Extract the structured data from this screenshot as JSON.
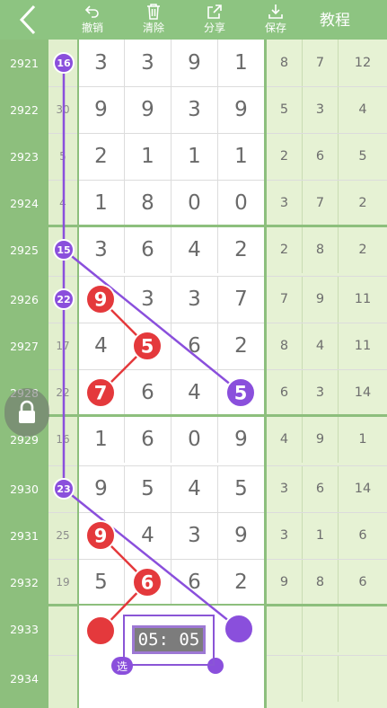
{
  "toolbar": {
    "undo_label": "撤销",
    "clear_label": "清除",
    "share_label": "分享",
    "save_label": "保存",
    "tutorial_label": "教程"
  },
  "colors": {
    "header_green": "#8dc481",
    "rownum_green": "#8dbf7d",
    "side_col_bg": "#e2efce",
    "right_col_bg": "#e6f2d4",
    "red_ball": "#e4393c",
    "purple_ball": "#8a4fdc"
  },
  "rows": [
    {
      "num": "2921",
      "side": "16",
      "main": [
        "3",
        "3",
        "9",
        "1"
      ],
      "right": [
        "8",
        "7",
        "12"
      ]
    },
    {
      "num": "2922",
      "side": "30",
      "main": [
        "9",
        "9",
        "3",
        "9"
      ],
      "right": [
        "5",
        "3",
        "4"
      ]
    },
    {
      "num": "2923",
      "side": "5",
      "main": [
        "2",
        "1",
        "1",
        "1"
      ],
      "right": [
        "2",
        "6",
        "5"
      ]
    },
    {
      "num": "2924",
      "side": "4",
      "main": [
        "1",
        "8",
        "0",
        "0"
      ],
      "right": [
        "3",
        "7",
        "2"
      ]
    },
    {
      "num": "2925",
      "side": "15",
      "main": [
        "3",
        "6",
        "4",
        "2"
      ],
      "right": [
        "2",
        "8",
        "2"
      ]
    },
    {
      "num": "2926",
      "side": "22",
      "main": [
        "9",
        "3",
        "3",
        "7"
      ],
      "right": [
        "7",
        "9",
        "11"
      ]
    },
    {
      "num": "2927",
      "side": "17",
      "main": [
        "4",
        "5",
        "6",
        "2"
      ],
      "right": [
        "8",
        "4",
        "11"
      ]
    },
    {
      "num": "2928",
      "side": "22",
      "main": [
        "7",
        "6",
        "4",
        "5"
      ],
      "right": [
        "6",
        "3",
        "14"
      ]
    },
    {
      "num": "2929",
      "side": "16",
      "main": [
        "1",
        "6",
        "0",
        "9"
      ],
      "right": [
        "4",
        "9",
        "1"
      ]
    },
    {
      "num": "2930",
      "side": "23",
      "main": [
        "9",
        "5",
        "4",
        "5"
      ],
      "right": [
        "3",
        "6",
        "14"
      ]
    },
    {
      "num": "2931",
      "side": "25",
      "main": [
        "9",
        "4",
        "3",
        "9"
      ],
      "right": [
        "3",
        "1",
        "6"
      ]
    },
    {
      "num": "2932",
      "side": "19",
      "main": [
        "5",
        "6",
        "6",
        "2"
      ],
      "right": [
        "9",
        "8",
        "6"
      ]
    },
    {
      "num": "2933",
      "side": "",
      "main": [
        "",
        "",
        "",
        ""
      ],
      "right": [
        "",
        "",
        ""
      ]
    },
    {
      "num": "2934",
      "side": "",
      "main": [
        "",
        "",
        "",
        ""
      ],
      "right": [
        "",
        "",
        ""
      ]
    }
  ],
  "markers": [
    {
      "kind": "purple-small",
      "label": "16",
      "row": 0,
      "col": "side"
    },
    {
      "kind": "purple-small",
      "label": "15",
      "row": 4,
      "col": "side"
    },
    {
      "kind": "purple-small",
      "label": "22",
      "row": 5,
      "col": "side"
    },
    {
      "kind": "purple-small",
      "label": "23",
      "row": 9,
      "col": "side"
    },
    {
      "kind": "red",
      "label": "9",
      "row": 5,
      "col": 0
    },
    {
      "kind": "red",
      "label": "5",
      "row": 6,
      "col": 1
    },
    {
      "kind": "red",
      "label": "7",
      "row": 7,
      "col": 0
    },
    {
      "kind": "purple",
      "label": "5",
      "row": 7,
      "col": 3
    },
    {
      "kind": "red",
      "label": "9",
      "row": 10,
      "col": 0
    },
    {
      "kind": "red",
      "label": "6",
      "row": 11,
      "col": 1
    }
  ],
  "timer": "05: 05",
  "select_tag": "选"
}
